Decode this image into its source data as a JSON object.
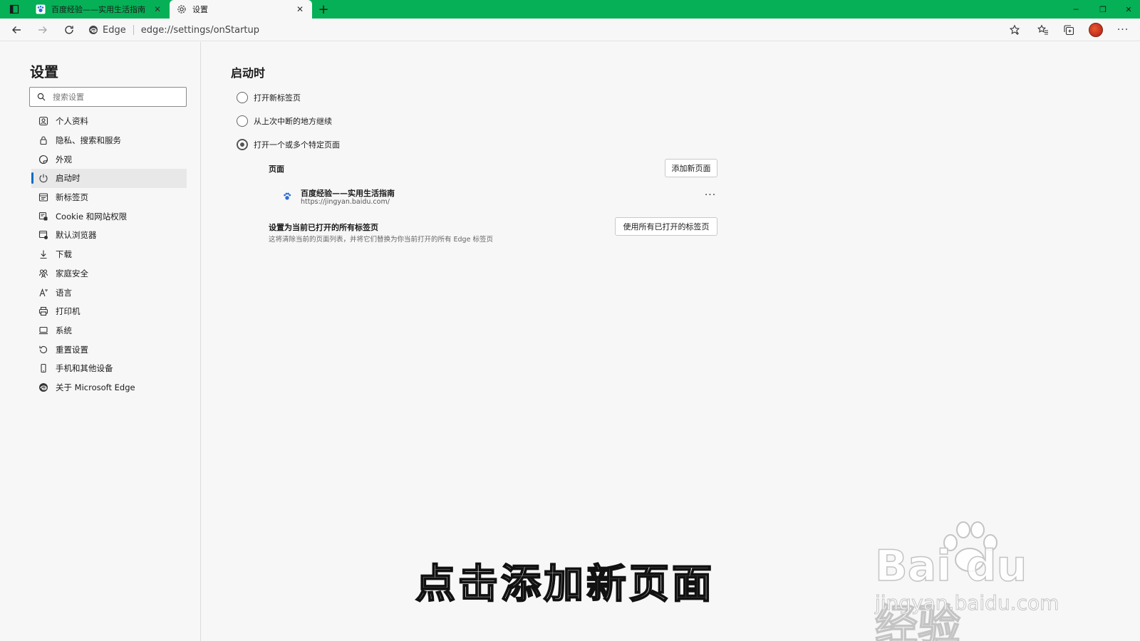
{
  "browser": {
    "tabs": [
      {
        "title": "百度经验——实用生活指南",
        "active": false
      },
      {
        "title": "设置",
        "active": true
      }
    ],
    "address": {
      "chip": "Edge",
      "url": "edge://settings/onStartup"
    },
    "accent": "#06b056"
  },
  "sidebar": {
    "title": "设置",
    "search_placeholder": "搜索设置",
    "items": [
      {
        "label": "个人资料",
        "icon": "profile-icon"
      },
      {
        "label": "隐私、搜索和服务",
        "icon": "lock-icon"
      },
      {
        "label": "外观",
        "icon": "appearance-icon"
      },
      {
        "label": "启动时",
        "icon": "power-icon",
        "selected": true
      },
      {
        "label": "新标签页",
        "icon": "newtab-icon"
      },
      {
        "label": "Cookie 和网站权限",
        "icon": "cookie-icon"
      },
      {
        "label": "默认浏览器",
        "icon": "browser-icon"
      },
      {
        "label": "下载",
        "icon": "download-icon"
      },
      {
        "label": "家庭安全",
        "icon": "family-icon"
      },
      {
        "label": "语言",
        "icon": "language-icon"
      },
      {
        "label": "打印机",
        "icon": "printer-icon"
      },
      {
        "label": "系统",
        "icon": "system-icon"
      },
      {
        "label": "重置设置",
        "icon": "reset-icon"
      },
      {
        "label": "手机和其他设备",
        "icon": "phone-icon"
      },
      {
        "label": "关于 Microsoft Edge",
        "icon": "edge-logo-icon"
      }
    ]
  },
  "main": {
    "heading": "启动时",
    "options": [
      {
        "label": "打开新标签页",
        "checked": false
      },
      {
        "label": "从上次中断的地方继续",
        "checked": false
      },
      {
        "label": "打开一个或多个特定页面",
        "checked": true
      }
    ],
    "pages_label": "页面",
    "add_button": "添加新页面",
    "pages": [
      {
        "title": "百度经验——实用生活指南",
        "url": "https://jingyan.baidu.com/"
      }
    ],
    "more_label": "···",
    "set_all_title": "设置为当前已打开的所有标签页",
    "set_all_desc": "这将清除当前的页面列表，并将它们替换为你当前打开的所有 Edge 标签页",
    "use_all_button": "使用所有已打开的标签页"
  },
  "overlay": {
    "caption": "点击添加新页面",
    "watermark_logo": "Bai du 经验",
    "watermark_url": "jingyan.baidu.com"
  }
}
